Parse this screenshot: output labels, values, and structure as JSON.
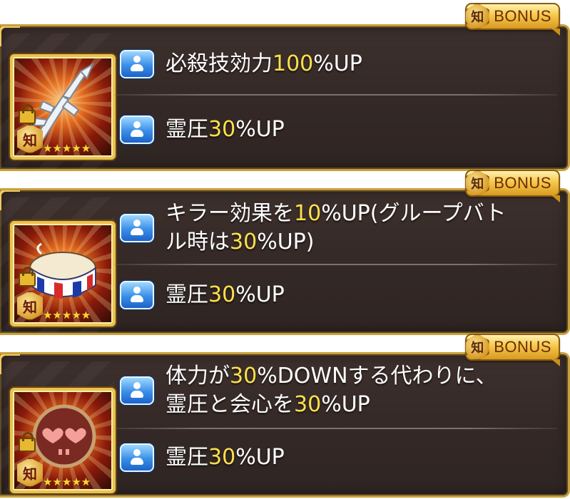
{
  "bonus": {
    "chi": "知",
    "label": "BONUS"
  },
  "badge_char": "知",
  "stars": "★★★★★",
  "accent": {
    "gold": "#e9c250",
    "highlight": "#ffe04a",
    "pill_blue": "#3a8ee8"
  },
  "cards": [
    {
      "icon": "spear-weapon-icon",
      "effects": [
        {
          "pre": "必殺技効力",
          "value": "100",
          "post": "%UP",
          "line2_pre": "",
          "line2_value": "",
          "line2_post": ""
        },
        {
          "pre": "霊圧",
          "value": "30",
          "post": "%UP",
          "line2_pre": "",
          "line2_value": "",
          "line2_post": ""
        }
      ]
    },
    {
      "icon": "wristband-icon",
      "effects": [
        {
          "pre": "キラー効果を",
          "value": "10",
          "post": "%UP(グループバト",
          "line2_pre": "ル時は",
          "line2_value": "30",
          "line2_post": "%UP)"
        },
        {
          "pre": "霊圧",
          "value": "30",
          "post": "%UP",
          "line2_pre": "",
          "line2_value": "",
          "line2_post": ""
        }
      ]
    },
    {
      "icon": "hearts-skull-badge-icon",
      "effects": [
        {
          "pre": "体力が",
          "value": "30",
          "post": "%DOWNする代わりに、",
          "line2_pre": "霊圧と会心を",
          "line2_value": "30",
          "line2_post": "%UP"
        },
        {
          "pre": "霊圧",
          "value": "30",
          "post": "%UP",
          "line2_pre": "",
          "line2_value": "",
          "line2_post": ""
        }
      ]
    }
  ]
}
